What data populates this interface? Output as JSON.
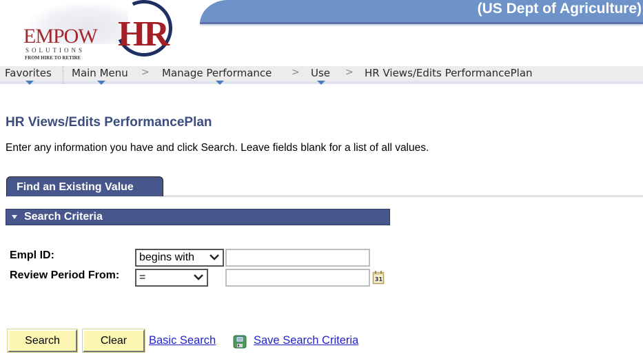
{
  "header": {
    "banner_text": "(US Dept of Agriculture)",
    "logo": {
      "empow_text": "EMPOW",
      "hr_text": "HR",
      "solutions_text": "SOLUTIONS",
      "tagline": "FROM HIRE TO RETIRE"
    }
  },
  "navbar": {
    "items": [
      {
        "label": "Favorites",
        "has_menu": true
      },
      {
        "label": "Main Menu",
        "has_menu": true
      },
      {
        "label": "Manage Performance",
        "has_menu": true
      },
      {
        "label": "Use",
        "has_menu": true
      },
      {
        "label": "HR Views/Edits PerformancePlan",
        "has_menu": false
      }
    ],
    "separator": ">"
  },
  "page": {
    "title": "HR Views/Edits PerformancePlan",
    "instructions": "Enter any information you have and click Search. Leave fields blank for a list of all values."
  },
  "tabs": [
    {
      "label": "Find an Existing Value",
      "active": true
    }
  ],
  "search_criteria": {
    "section_label": "Search Criteria",
    "fields": [
      {
        "label": "Empl ID:",
        "operator": "begins with",
        "value": ""
      },
      {
        "label": "Review Period From:",
        "operator": "=",
        "value": ""
      }
    ]
  },
  "actions": {
    "search_label": "Search",
    "clear_label": "Clear",
    "basic_search_label": "Basic Search",
    "save_search_label": "Save Search Criteria"
  },
  "icons": {
    "nav_caret": "caret-down-icon",
    "section_toggle": "triangle-down-icon",
    "calendar": "calendar-icon",
    "save": "floppy-disk-icon"
  },
  "colors": {
    "banner": "#6d93c8",
    "title": "#3b4d80",
    "tab_bg": "#48578b",
    "button_bg": "#fbf7b3",
    "link": "#2222cc"
  }
}
